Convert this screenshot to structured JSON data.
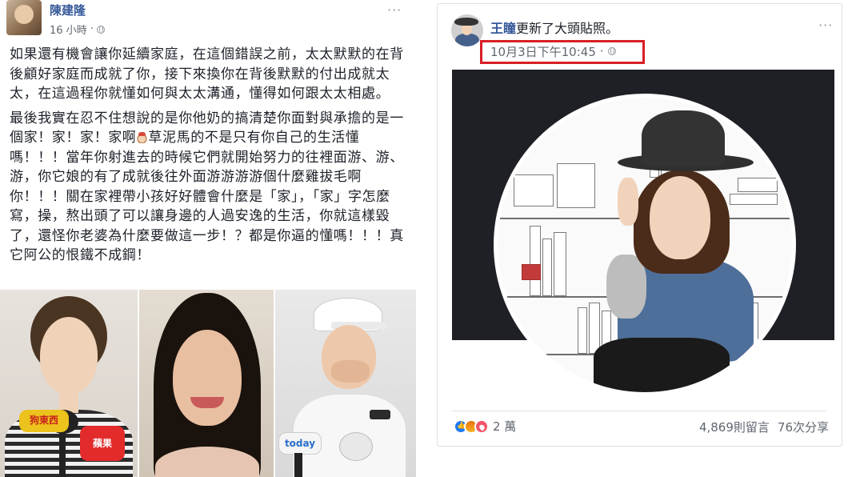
{
  "left_post": {
    "author": "陳建隆",
    "time": "16 小時",
    "more": "···",
    "paragraph1": "如果還有機會讓你延續家庭，在這個錯誤之前，太太默默的在背後顧好家庭而成就了你，接下來換你在背後默默的付出成就太太，在這過程你就懂如何與太太溝通，懂得如何跟太太相處。",
    "paragraph2_a": "最後我實在忍不住想說的是你他奶的搞清楚你面對與承擔的是一個家！家！家！家啊",
    "paragraph2_b": "草泥馬的不是只有你自己的生活懂嗎！！！當年你射進去的時候它們就開始努力的往裡面游、游、游，你它娘的有了成就後往外面游游游游個什麼雞拔毛啊你！！！關在家裡帶小孩好好體會什麼是「家」，「家」字怎麼寫，操，熬出頭了可以讓身邊的人過安逸的生活，你就這樣毀了，還怪你老婆為什麼要做這一步！？都是你逼的懂嗎！！！真它阿公的恨鐵不成鋼！",
    "emoji": "horse-face-emoji",
    "photos": {
      "mic_logo_1": "狗東西",
      "mic_logo_2": "蘋果",
      "mic_logo_3": "today"
    }
  },
  "right_post": {
    "author": "王瞳",
    "action": "更新了大頭貼照。",
    "timestamp": "10月3日下午10:45",
    "separator": "·",
    "more": "···",
    "reaction_count": "2 萬",
    "comments": "4,869則留言",
    "shares": "76次分享",
    "highlight_color": "#d81f26"
  },
  "colors": {
    "link": "#365899",
    "meta": "#606770",
    "cover_bg": "#1e2026"
  }
}
